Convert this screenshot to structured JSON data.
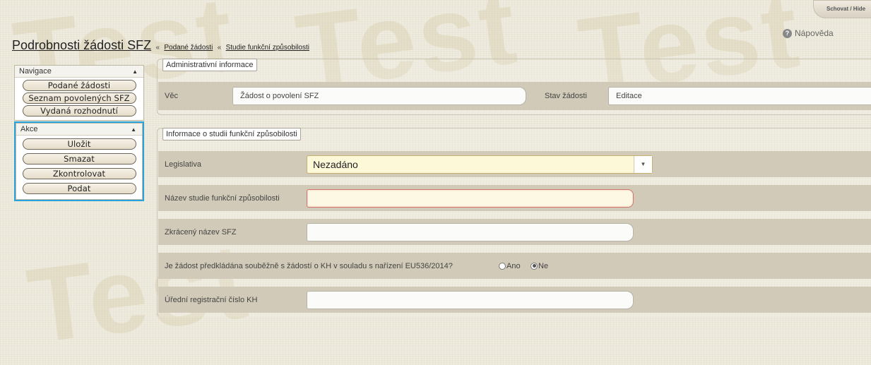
{
  "top_bar": {
    "toggle_label": "Schovat / Hide"
  },
  "help": {
    "label": "Nápověda",
    "icon": "question-icon"
  },
  "header": {
    "title": "Podrobnosti žádosti SFZ",
    "separator": "«",
    "breadcrumbs": [
      "Podané žádosti",
      "Studie funkční způsobilosti"
    ]
  },
  "watermark": "Test",
  "navigation": {
    "title": "Navigace",
    "items": [
      "Podané žádosti",
      "Seznam povolených SFZ",
      "Vydaná rozhodnutí"
    ]
  },
  "actions": {
    "title": "Akce",
    "items": [
      "Uložit",
      "Smazat",
      "Zkontrolovat",
      "Podat"
    ]
  },
  "admin_section": {
    "legend": "Administrativní informace",
    "subject_label": "Věc",
    "subject_value": "Žádost o povolení SFZ",
    "status_label": "Stav žádosti",
    "status_value": "Editace"
  },
  "study_section": {
    "legend": "Informace o studii funkční způsobilosti",
    "legislation_label": "Legislativa",
    "legislation_value": "Nezadáno",
    "study_name_label": "Název studie funkční způsobilosti",
    "study_name_value": "",
    "short_name_label": "Zkrácený název SFZ",
    "short_name_value": "",
    "question_label": "Je žádost předkládána souběžně s žádostí o KH v souladu s nařízení EU536/2014?",
    "option_yes": "Ano",
    "option_no": "Ne",
    "selected_option": "Ne",
    "reg_number_label": "Úřední registrační číslo KH",
    "reg_number_value": ""
  },
  "colors": {
    "accent_highlight": "#29a3dc",
    "required_border": "#d3766f",
    "row_bg": "#d2cab8"
  }
}
